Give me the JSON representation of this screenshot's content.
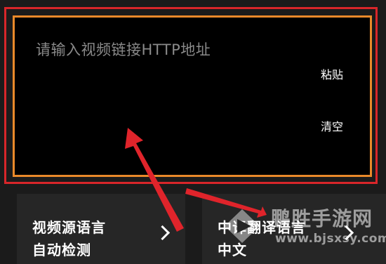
{
  "input": {
    "placeholder": "请输入视频链接HTTP地址",
    "paste_label": "粘贴",
    "clear_label": "清空"
  },
  "cards": {
    "source_language": {
      "title": "视频源语言",
      "value": "自动检测"
    },
    "translate_language": {
      "title": "中译翻译语言",
      "value": "中文"
    }
  },
  "watermark": {
    "name": "鹏胜手游网",
    "url": "www.bjsxsy.com"
  },
  "colors": {
    "outer_frame": "#d8262a",
    "inner_frame": "#e9892a",
    "annotation_arrow": "#e0242b"
  }
}
